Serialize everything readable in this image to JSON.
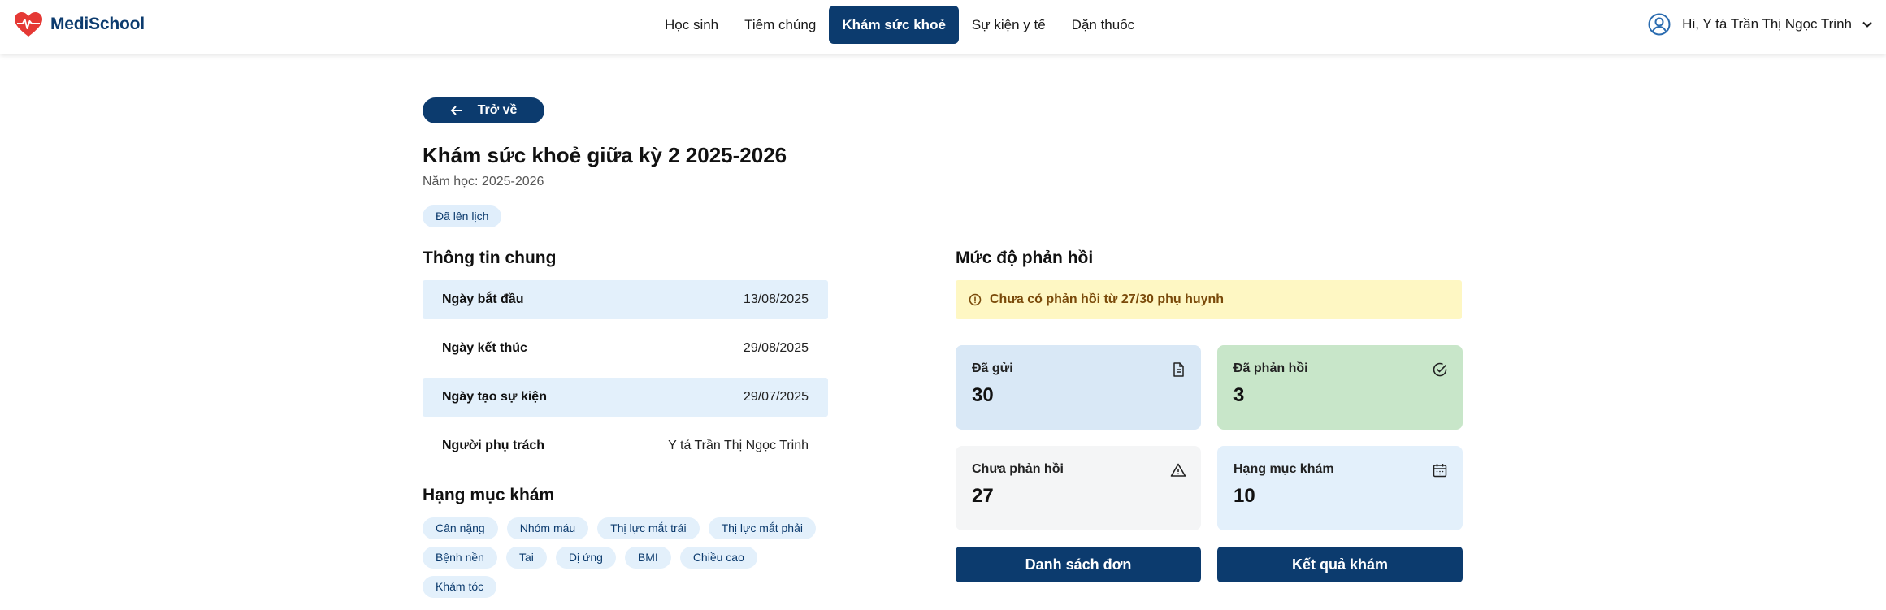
{
  "header": {
    "brand": "MediSchool",
    "nav": [
      {
        "label": "Học sinh",
        "active": false
      },
      {
        "label": "Tiêm chủng",
        "active": false
      },
      {
        "label": "Khám sức khoẻ",
        "active": true
      },
      {
        "label": "Sự kiện y tế",
        "active": false
      },
      {
        "label": "Dặn thuốc",
        "active": false
      }
    ],
    "user_greeting": "Hi, Y tá Trần Thị Ngọc Trinh"
  },
  "back_label": "Trở về",
  "event": {
    "title": "Khám sức khoẻ giữa kỳ 2 2025-2026",
    "school_year": "Năm học: 2025-2026",
    "status": "Đã lên lịch"
  },
  "general_info": {
    "title": "Thông tin chung",
    "rows": [
      {
        "label": "Ngày bắt đầu",
        "value": "13/08/2025"
      },
      {
        "label": "Ngày kết thúc",
        "value": "29/08/2025"
      },
      {
        "label": "Ngày tạo sự kiện",
        "value": "29/07/2025"
      },
      {
        "label": "Người phụ trách",
        "value": "Y tá Trần Thị Ngọc Trinh"
      }
    ]
  },
  "exam_items": {
    "title": "Hạng mục khám",
    "rows": [
      [
        "Cân nặng",
        "Nhóm máu",
        "Thị lực mắt trái",
        "Thị lực mắt phải"
      ],
      [
        "Bệnh nền",
        "Tai",
        "Dị ứng",
        "BMI",
        "Chiều cao"
      ],
      [
        "Khám tóc"
      ]
    ]
  },
  "response": {
    "title": "Mức độ phản hồi",
    "alert": "Chưa có phản hồi từ 27/30 phụ huynh",
    "stats": {
      "sent": {
        "label": "Đã gửi",
        "value": "30",
        "icon": "document-icon"
      },
      "responded": {
        "label": "Đã phản hồi",
        "value": "3",
        "icon": "check-circle-icon"
      },
      "pending": {
        "label": "Chưa phản hồi",
        "value": "27",
        "icon": "warning-icon"
      },
      "items": {
        "label": "Hạng mục khám",
        "value": "10",
        "icon": "calendar-icon"
      }
    },
    "buttons": {
      "list": "Danh sách đơn",
      "results": "Kết quả khám"
    }
  },
  "colors": {
    "primary": "#0c3b6e",
    "brand_red": "#e53935",
    "alert_bg": "#fef7c3",
    "responded_bg": "#c8e6c9"
  }
}
